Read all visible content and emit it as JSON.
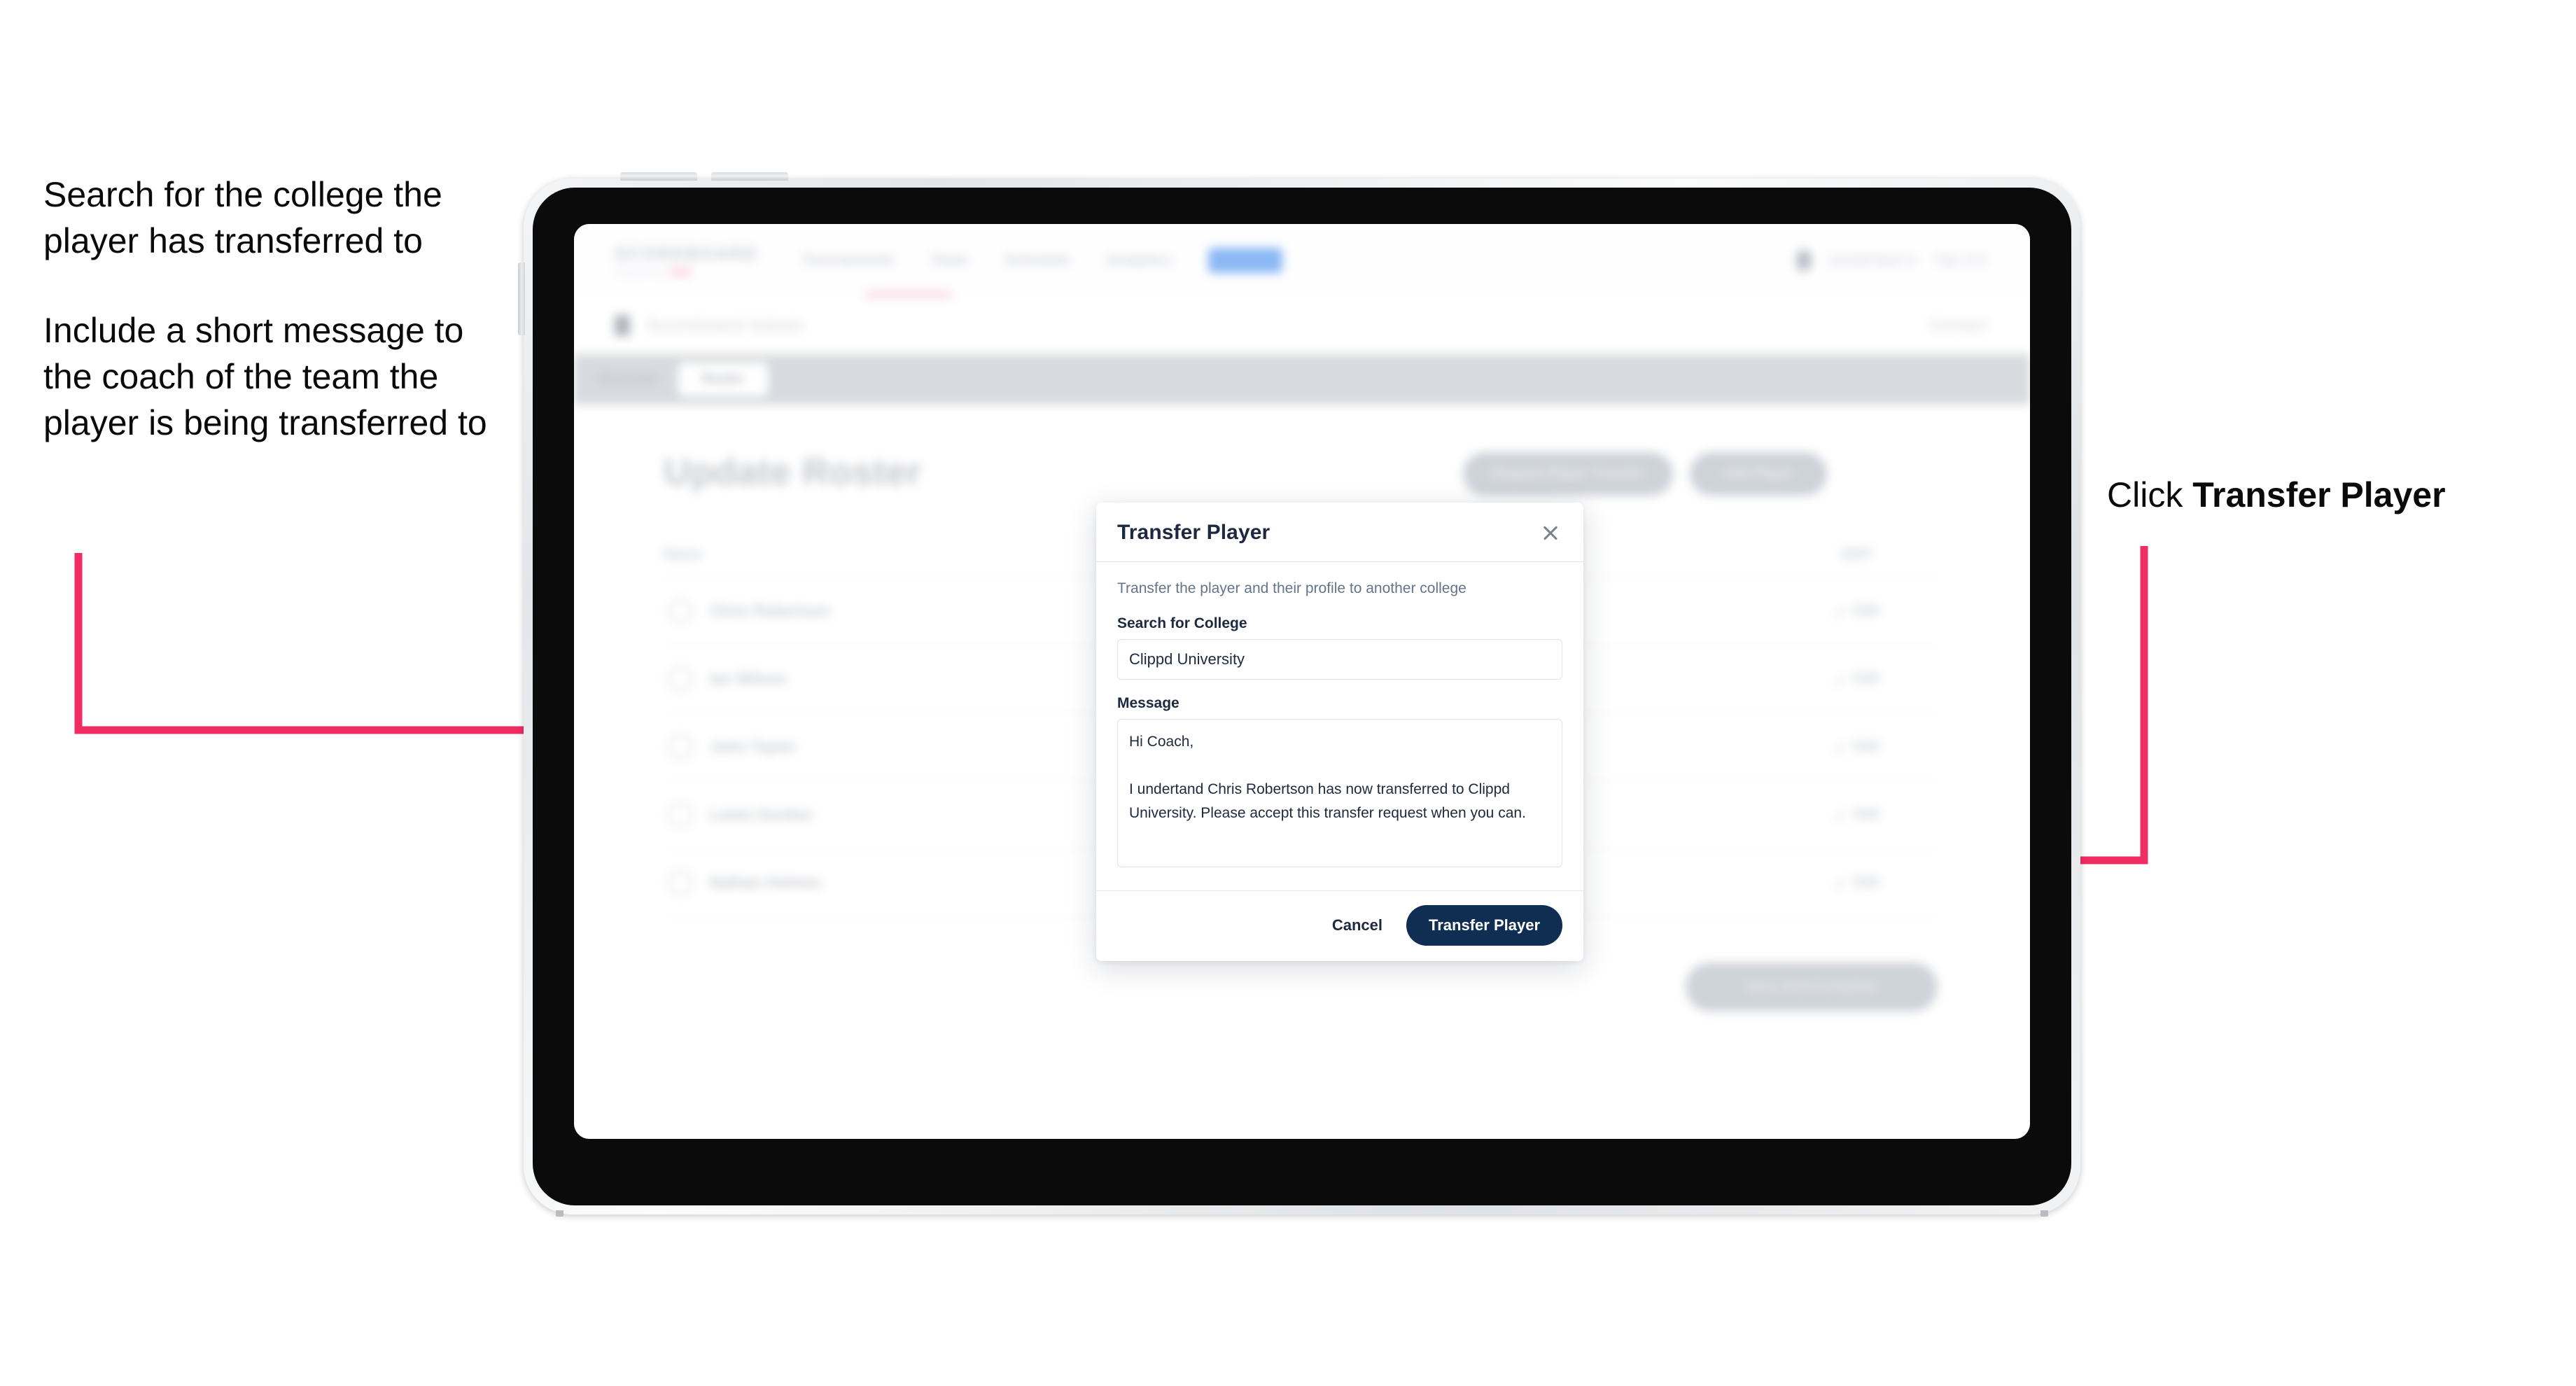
{
  "annotations": {
    "left": [
      "Search for the college the player has transferred to",
      "Include a short message to the coach of the team the player is being transferred to"
    ],
    "right_prefix": "Click ",
    "right_bold": "Transfer Player",
    "arrow_color": "#ef2d62"
  },
  "app": {
    "brand": {
      "name": "SCOREBOARD",
      "sub": "Powered by",
      "badge": ""
    },
    "topnav": [
      {
        "label": "Tournaments"
      },
      {
        "label": "Team"
      },
      {
        "label": "Schedule"
      },
      {
        "label": "Analytics"
      },
      {
        "label": "Roster"
      }
    ],
    "topbar_right": {
      "user": "paul@clippd.io",
      "signout": "Sign Out"
    },
    "subbar": {
      "title": "Scoreboard",
      "title_light": "Admin",
      "right": "Connect"
    },
    "tabs": [
      {
        "label": "Overview",
        "active": false
      },
      {
        "label": "Roster",
        "active": true
      }
    ],
    "page_title": "Update Roster",
    "header_buttons": [
      {
        "label": "Request Player Transfer"
      },
      {
        "label": "Add Player"
      }
    ],
    "table": {
      "columns": [
        "Name",
        "EDIT"
      ],
      "rows": [
        {
          "name": "Chris Robertson",
          "action": "Edit"
        },
        {
          "name": "Ian Wilson",
          "action": "Edit"
        },
        {
          "name": "John Taylor",
          "action": "Edit"
        },
        {
          "name": "Lewis Gordon",
          "action": "Edit"
        },
        {
          "name": "Nathan Holmes",
          "action": "Edit"
        }
      ]
    },
    "save_button": "Save And Complete"
  },
  "modal": {
    "title": "Transfer Player",
    "close_icon": "close-icon",
    "description": "Transfer the player and their profile to another college",
    "college_label": "Search for College",
    "college_value": "Clippd University",
    "college_placeholder": "Search for College",
    "message_label": "Message",
    "message_value": "Hi Coach,\n\nI undertand Chris Robertson has now transferred to Clippd University. Please accept this transfer request when you can.",
    "message_placeholder": "Message",
    "cancel_label": "Cancel",
    "submit_label": "Transfer Player",
    "submit_color": "#0f2e52"
  }
}
